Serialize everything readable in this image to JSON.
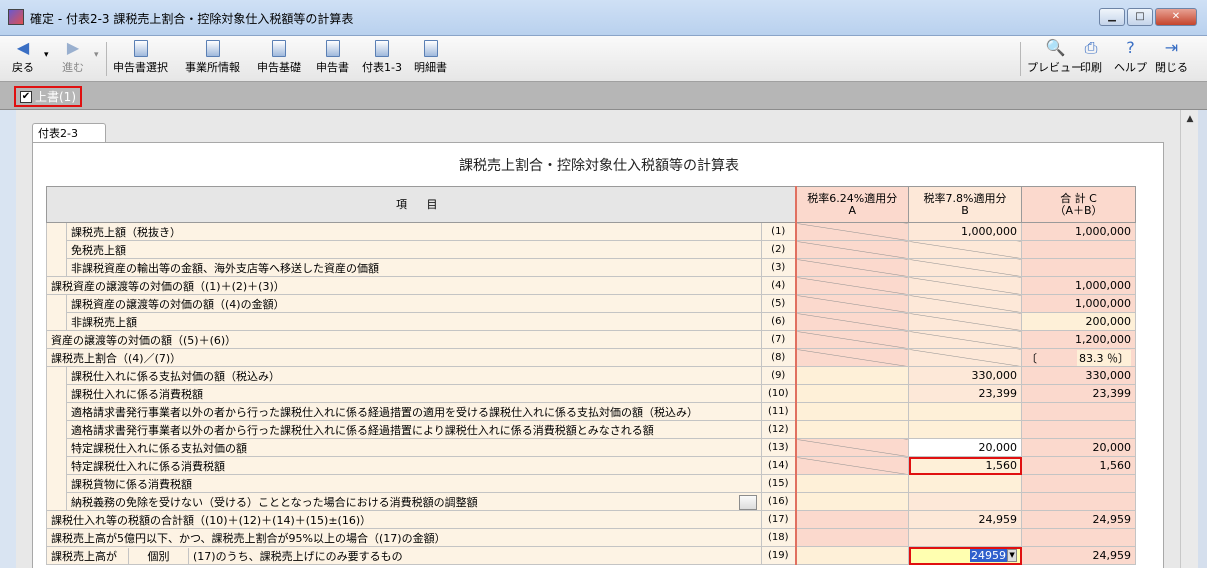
{
  "window": {
    "title": "確定 - 付表2-3 課税売上割合・控除対象仕入税額等の計算表"
  },
  "toolbar": {
    "back": "戻る",
    "forward": "進む",
    "items": [
      "申告書選択",
      "事業所情報",
      "申告基礎",
      "申告書",
      "付表1-3",
      "明細書"
    ],
    "right": [
      "プレビュー",
      "印刷",
      "ヘルプ",
      "閉じる"
    ]
  },
  "overwrite": {
    "label": "上書(1)",
    "checked": true
  },
  "tab": "付表2-3",
  "sheet": {
    "title": "課税売上割合・控除対象仕入税額等の計算表",
    "headers": {
      "item": "項 目",
      "a": "税率6.24%適用分",
      "a_sub": "A",
      "b": "税率7.8%適用分",
      "b_sub": "B",
      "c": "合 計 C",
      "c_sub": "（A＋B）"
    },
    "rows": [
      {
        "label": "課税売上額（税抜き）",
        "num": "(1)",
        "b": "1,000,000",
        "c": "1,000,000"
      },
      {
        "label": "免税売上額",
        "num": "(2)",
        "b": "",
        "c": ""
      },
      {
        "label": "非課税資産の輸出等の金額、海外支店等へ移送した資産の価額",
        "num": "(3)",
        "b": "",
        "c": ""
      },
      {
        "label": "課税資産の譲渡等の対価の額（(1)＋(2)＋(3)）",
        "num": "(4)",
        "b": "",
        "c": "1,000,000"
      },
      {
        "label": "課税資産の譲渡等の対価の額（(4)の金額）",
        "num": "(5)",
        "b": "",
        "c": "1,000,000"
      },
      {
        "label": "非課税売上額",
        "num": "(6)",
        "b": "",
        "c": "200,000"
      },
      {
        "label": "資産の譲渡等の対価の額（(5)＋(6)）",
        "num": "(7)",
        "b": "",
        "c": "1,200,000"
      },
      {
        "label": "課税売上割合（(4)／(7)）",
        "num": "(8)",
        "c_open": "〔",
        "c": "83.3 ％〕"
      },
      {
        "label": "課税仕入れに係る支払対価の額（税込み）",
        "num": "(9)",
        "b": "330,000",
        "c": "330,000"
      },
      {
        "label": "課税仕入れに係る消費税額",
        "num": "(10)",
        "b": "23,399",
        "c": "23,399"
      },
      {
        "label": "適格請求書発行事業者以外の者から行った課税仕入れに係る経過措置の適用を受ける課税仕入れに係る支払対価の額（税込み）",
        "num": "(11)",
        "b": "",
        "c": ""
      },
      {
        "label": "適格請求書発行事業者以外の者から行った課税仕入れに係る経過措置により課税仕入れに係る消費税額とみなされる額",
        "num": "(12)",
        "b": "",
        "c": ""
      },
      {
        "label": "特定課税仕入れに係る支払対価の額",
        "num": "(13)",
        "b": "20,000",
        "c": "20,000"
      },
      {
        "label": "特定課税仕入れに係る消費税額",
        "num": "(14)",
        "b": "1,560",
        "c": "1,560"
      },
      {
        "label": "課税貨物に係る消費税額",
        "num": "(15)",
        "b": "",
        "c": ""
      },
      {
        "label": "納税義務の免除を受けない（受ける）こととなった場合における消費税額の調整額",
        "num": "(16)",
        "b": "",
        "c": ""
      },
      {
        "label": "課税仕入れ等の税額の合計額（(10)＋(12)＋(14)＋(15)±(16)）",
        "num": "(17)",
        "b": "24,959",
        "c": "24,959"
      },
      {
        "label": "課税売上高が5億円以下、かつ、課税売上割合が95%以上の場合（(17)の金額）",
        "num": "(18)",
        "b": "",
        "c": ""
      },
      {
        "label": "(17)のうち、課税売上げにのみ要するもの",
        "num": "(19)",
        "b": "24959",
        "c": "24,959",
        "side1": "課税売上高が",
        "side2": "個別"
      }
    ]
  }
}
